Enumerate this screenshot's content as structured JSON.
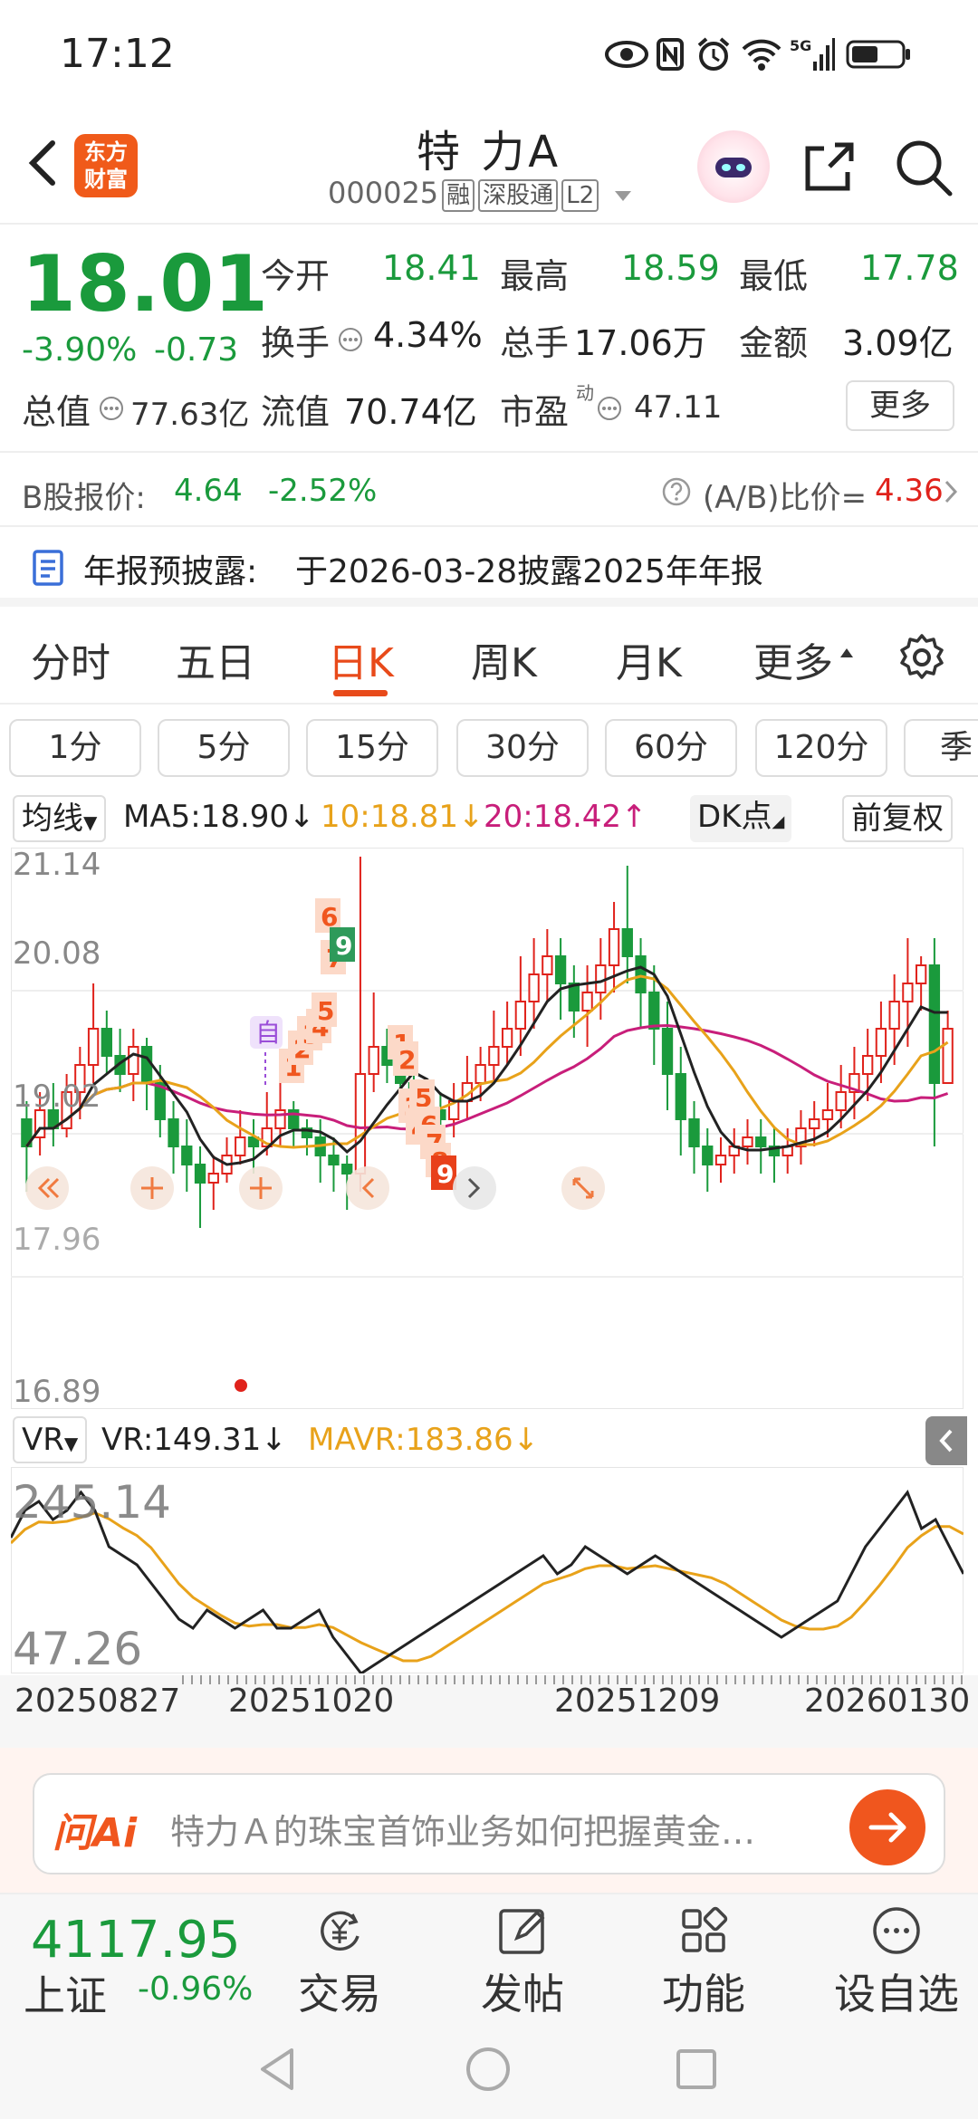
{
  "status_bar": {
    "time": "17:12"
  },
  "header": {
    "logo_line1": "东方",
    "logo_line2": "财富",
    "stock_name": "特 力A",
    "stock_code": "000025",
    "tags": [
      "融",
      "深股通",
      "L2"
    ]
  },
  "quote": {
    "price": "18.01",
    "change_pct": "-3.90%",
    "change_val": "-0.73",
    "open_label": "今开",
    "open_val": "18.41",
    "high_label": "最高",
    "high_val": "18.59",
    "low_label": "最低",
    "low_val": "17.78",
    "turnover_label": "换手",
    "turnover_val": "4.34%",
    "volume_label": "总手",
    "volume_val": "17.06万",
    "amount_label": "金额",
    "amount_val": "3.09亿",
    "mktcap_label": "总值",
    "mktcap_val": "77.63亿",
    "float_label": "流值",
    "float_val": "70.74亿",
    "pe_label": "市盈",
    "pe_sup": "动",
    "pe_val": "47.11",
    "more_label": "更多"
  },
  "bshare": {
    "label": "B股报价:",
    "price": "4.64",
    "change": "-2.52%",
    "ratio_label": "(A/B)比价=",
    "ratio_val": "4.36"
  },
  "notice": {
    "label": "年报预披露:",
    "text": "于2026-03-28披露2025年年报"
  },
  "period_tabs": [
    "分时",
    "五日",
    "日K",
    "周K",
    "月K",
    "更多"
  ],
  "active_tab": "日K",
  "minute_buttons": [
    "1分",
    "5分",
    "15分",
    "30分",
    "60分",
    "120分",
    "季"
  ],
  "indicators": {
    "ma_select": "均线",
    "ma5": "MA5:18.90↓",
    "ma10": "10:18.81↓",
    "ma20": "20:18.42↑",
    "dk": "DK点",
    "adjust": "前复权",
    "colors": {
      "ma5": "#222222",
      "ma10": "#e8a21a",
      "ma20": "#c81e7a",
      "up": "#e0221b",
      "down": "#1a9a3c"
    }
  },
  "chart_axis": {
    "y_top": "21.14",
    "y_mid1": "20.08",
    "y_mid2": "19.02",
    "y_mid3": "17.96",
    "y_bottom": "16.89"
  },
  "signal_marks": {
    "upper": [
      "1",
      "2",
      "3",
      "4",
      "5",
      "6",
      "7",
      "9"
    ],
    "lower": [
      "1",
      "2",
      "3",
      "4",
      "5",
      "6",
      "7",
      "8",
      "9"
    ],
    "auto_label": "自"
  },
  "vr": {
    "select": "VR",
    "vr_val": "VR:149.31↓",
    "mavr_val": "MAVR:183.86↓",
    "y_top": "245.14",
    "y_bottom": "47.26"
  },
  "dates": [
    "20250827",
    "20251020",
    "20251209",
    "20260130"
  ],
  "ai": {
    "logo": "问Ai",
    "prompt": "特力Ａ的珠宝首饰业务如何把握黄金…"
  },
  "bottom_bar": {
    "index_val": "4117.95",
    "index_name": "上证",
    "index_chg": "-0.96%",
    "items": [
      "交易",
      "发帖",
      "功能",
      "设自选"
    ]
  }
}
